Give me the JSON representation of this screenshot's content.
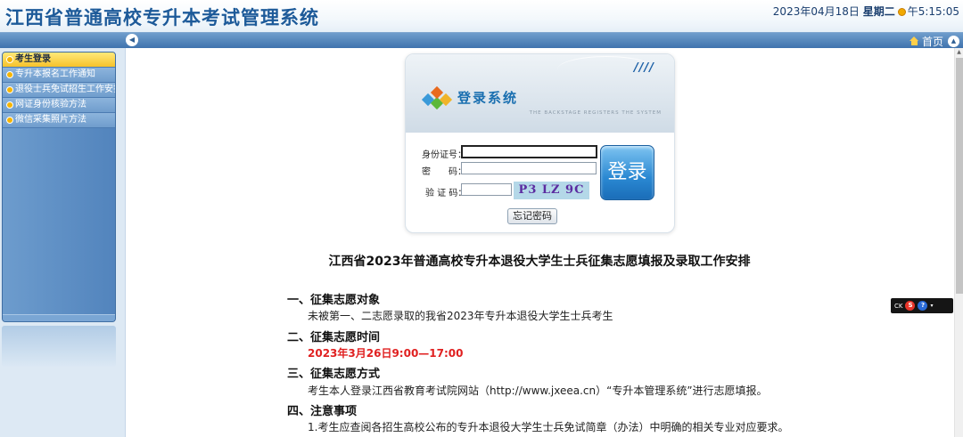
{
  "header": {
    "title": "江西省普通高校专升本考试管理系统",
    "date": "2023年04月18日",
    "weekday": "星期二",
    "time": "午5:15:05"
  },
  "navbar": {
    "home_label": "首页"
  },
  "sidebar": {
    "items": [
      {
        "label": "考生登录"
      },
      {
        "label": "专升本报名工作通知"
      },
      {
        "label": "退役士兵免试招生工作安排"
      },
      {
        "label": "网证身份核验方法"
      },
      {
        "label": "微信采集照片方法"
      }
    ]
  },
  "login": {
    "heading": "登录系统",
    "subtitle": "THE BACKSTAGE REGISTERS THE SYSTEM",
    "id_label": "身份证号：",
    "password_label": "密　　码：",
    "captcha_label": "验 证 码：",
    "captcha_text": "P3 LZ 9C",
    "login_button": "登录",
    "forgot_button": "忘记密码"
  },
  "notice": {
    "title": "江西省2023年普通高校专升本退役大学生士兵征集志愿填报及录取工作安排",
    "sections": [
      {
        "heading": "一、征集志愿对象",
        "text": "未被第一、二志愿录取的我省2023年专升本退役大学生士兵考生"
      },
      {
        "heading": "二、征集志愿时间",
        "text": "2023年3月26日9:00—17:00"
      },
      {
        "heading": "三、征集志愿方式",
        "text": "考生本人登录江西省教育考试院网站（http://www.jxeea.cn）“专升本管理系统”进行志愿填报。"
      },
      {
        "heading": "四、注意事项",
        "text": "1.考生应查阅各招生高校公布的专升本退役大学生士兵免试简章（办法）中明确的相关专业对应要求。"
      }
    ]
  },
  "float_toolbar": {
    "label": "CK"
  },
  "colors": {
    "title_blue": "#1d5a99",
    "nav_blue": "#3f73ad",
    "active_item": "#f6c22b",
    "highlight_red": "#e02020"
  }
}
